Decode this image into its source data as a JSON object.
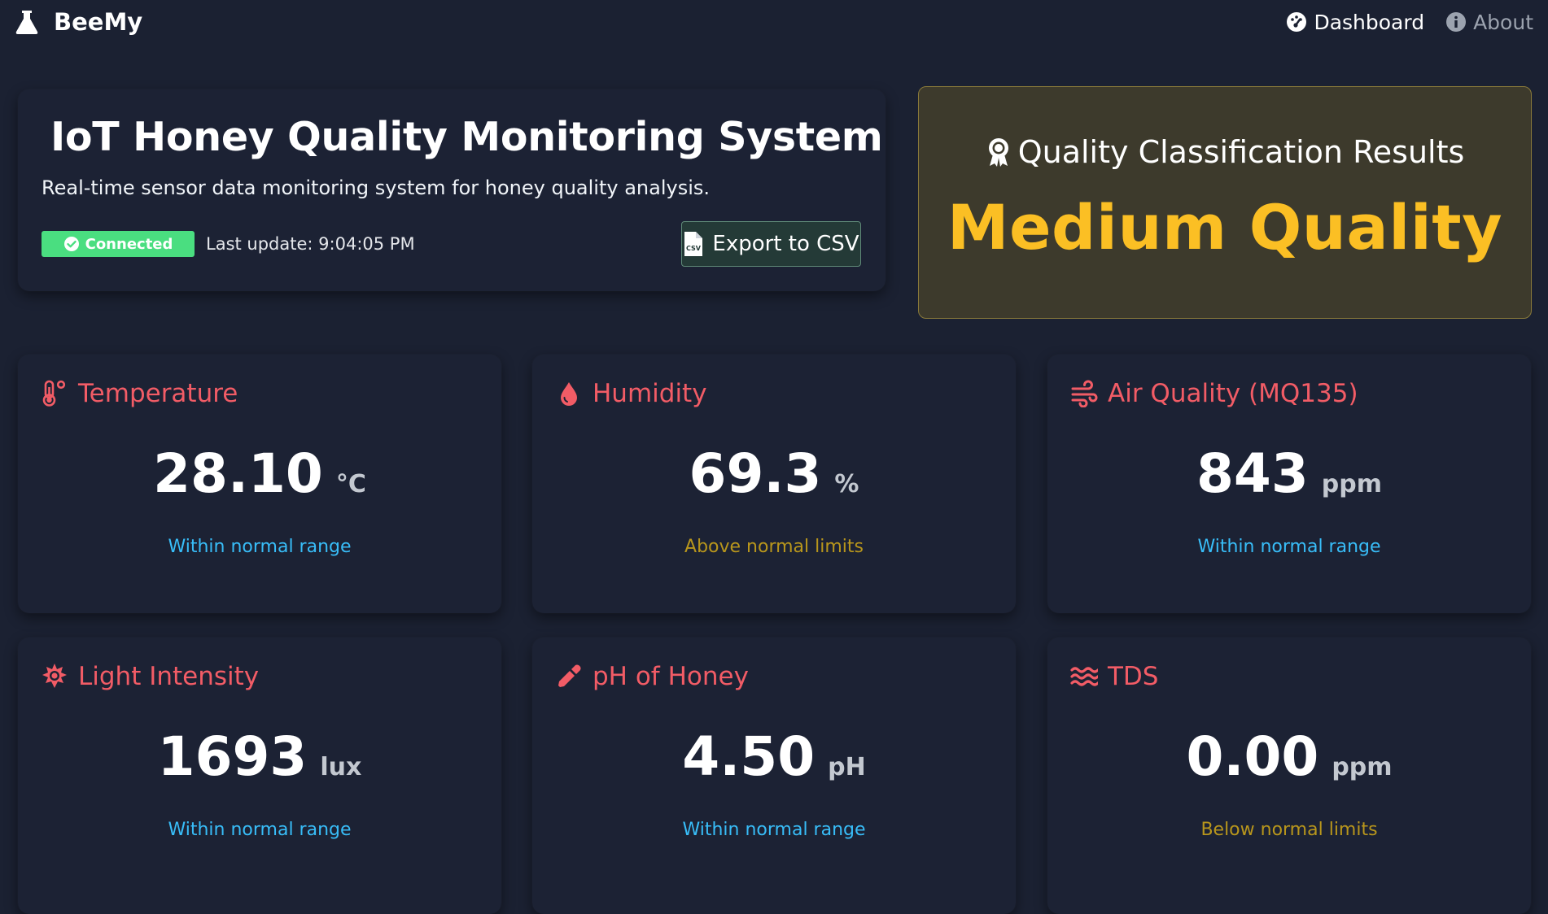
{
  "navbar": {
    "brand": "BeeMy",
    "links": [
      {
        "label": "Dashboard",
        "icon": "gauge-icon"
      },
      {
        "label": "About",
        "icon": "info-icon"
      }
    ]
  },
  "header": {
    "title": "IoT Honey Quality Monitoring System",
    "subtitle": "Real-time sensor data monitoring system for honey quality analysis.",
    "status_badge": "Connected",
    "last_update": "Last update: 9:04:05 PM",
    "export_label": "Export to CSV"
  },
  "quality": {
    "title": "Quality Classification Results",
    "value": "Medium Quality",
    "accent_color": "#fbbf24"
  },
  "sensors": [
    {
      "label": "Temperature",
      "value": "28.10",
      "unit": "°C",
      "status": "Within normal range",
      "status_type": "normal",
      "icon": "thermometer-icon"
    },
    {
      "label": "Humidity",
      "value": "69.3",
      "unit": "%",
      "status": "Above normal limits",
      "status_type": "warning",
      "icon": "droplet-icon"
    },
    {
      "label": "Air Quality (MQ135)",
      "value": "843",
      "unit": "ppm",
      "status": "Within normal range",
      "status_type": "normal",
      "icon": "wind-icon"
    },
    {
      "label": "Light Intensity",
      "value": "1693",
      "unit": "lux",
      "status": "Within normal range",
      "status_type": "normal",
      "icon": "sun-icon"
    },
    {
      "label": "pH of Honey",
      "value": "4.50",
      "unit": "pH",
      "status": "Within normal range",
      "status_type": "normal",
      "icon": "eyedropper-icon"
    },
    {
      "label": "TDS",
      "value": "0.00",
      "unit": "ppm",
      "status": "Below normal limits",
      "status_type": "warning",
      "icon": "water-icon"
    }
  ],
  "colors": {
    "background": "#1b2132",
    "sensor_label": "#f25c66",
    "status_normal": "#38bdf8",
    "status_warning": "#b8961c",
    "connected": "#4ade80"
  }
}
